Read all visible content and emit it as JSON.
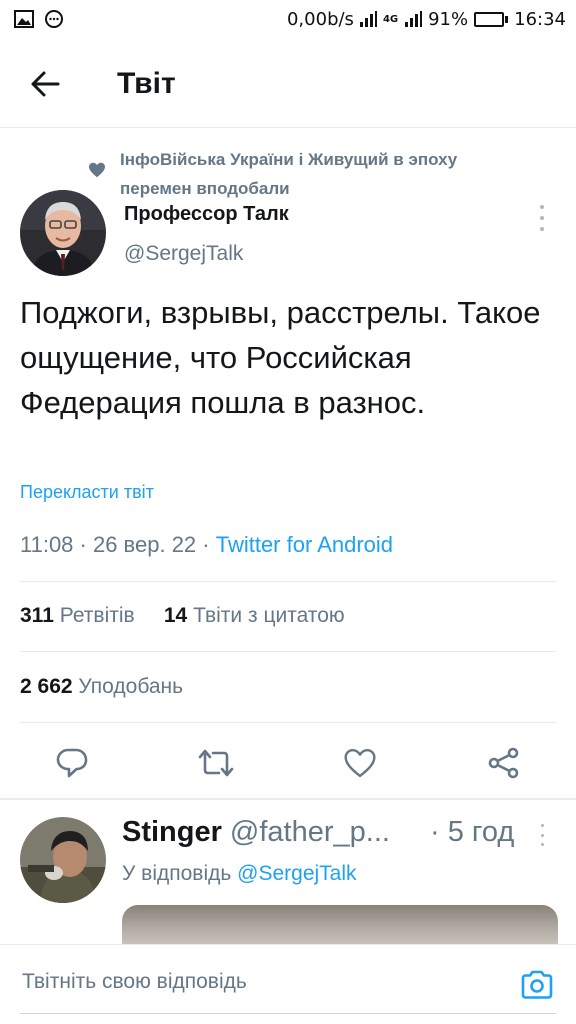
{
  "status_bar": {
    "net_speed": "0,00b/s",
    "network_type": "4G",
    "battery": "91%",
    "battery_level": 0.91,
    "time": "16:34",
    "icons": [
      "image-icon",
      "chat-icon",
      "signal-icon",
      "battery-icon"
    ]
  },
  "header": {
    "title": "Твіт",
    "back_icon": "arrow-left-icon"
  },
  "tweet": {
    "social_context": "ІнфоВійська України і Живущий в эпоху перемен вподобали",
    "author_name": "Профессор Талк",
    "author_handle": "@SergejTalk",
    "text": "Поджоги, взрывы, расстрелы. Такое ощущение, что Российская Федерация пошла в разнос.",
    "translate_label": "Перекласти твіт",
    "time": "11:08 · 26 вер. 22 · ",
    "source": "Twitter for Android",
    "retweets_count": "311",
    "retweets_label": "Ретвітів",
    "quotes_count": "14",
    "quotes_label": "Твіти з цитатою",
    "likes_count": "2 662",
    "likes_label": "Уподобань"
  },
  "actions": [
    "reply-icon",
    "retweet-icon",
    "like-icon",
    "share-icon"
  ],
  "reply": {
    "name": "Stinger",
    "handle": "@father_p...",
    "time": "· 5 год",
    "replying_to_prefix": "У відповідь ",
    "replying_to_mention": "@SergejTalk"
  },
  "composer": {
    "placeholder": "Твітніть свою відповідь",
    "value": ""
  },
  "colors": {
    "accent": "#1da1f2",
    "secondary_text": "#657786",
    "primary_text": "#14171a",
    "divider": "#e6ecf0"
  }
}
